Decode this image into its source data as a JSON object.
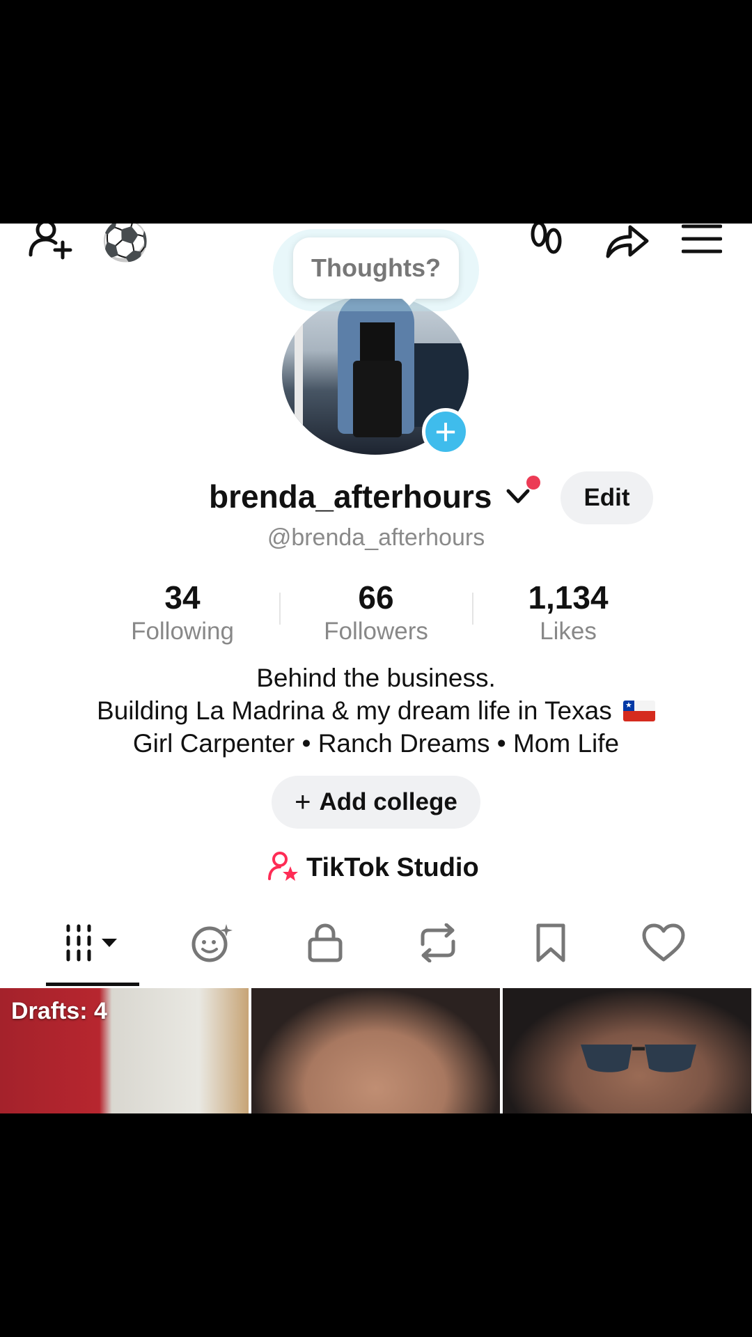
{
  "profile": {
    "tooltip": "Thoughts?",
    "display_name": "brenda_afterhours",
    "username": "@brenda_afterhours",
    "edit_label": "Edit"
  },
  "stats": [
    {
      "value": "34",
      "label": "Following"
    },
    {
      "value": "66",
      "label": "Followers"
    },
    {
      "value": "1,134",
      "label": "Likes"
    }
  ],
  "bio": {
    "line1": "Behind the business.",
    "line2": "Building La Madrina & my dream life in Texas",
    "line3": "Girl Carpenter • Ranch Dreams • Mom Life"
  },
  "add_college_label": "Add college",
  "studio_label": "TikTok Studio",
  "tabs": [
    "videos-icon",
    "ai-self-icon",
    "lock-icon",
    "repost-icon",
    "bookmark-icon",
    "heart-icon"
  ],
  "thumbnails": {
    "drafts_label": "Drafts: 4"
  },
  "colors": {
    "accent_blue": "#3fbcec",
    "notification_red": "#ec3b55",
    "studio_red": "#fe2c55"
  },
  "soccer_emoji": "⚽"
}
